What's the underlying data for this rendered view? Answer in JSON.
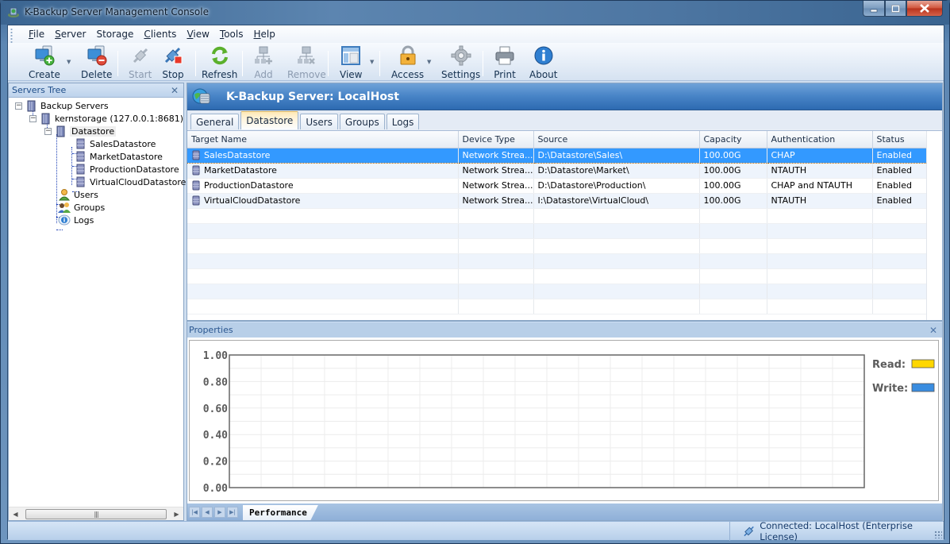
{
  "window": {
    "title": "K-Backup Server Management Console",
    "controls": {
      "minimize": "minimize",
      "maximize": "maximize",
      "close": "close"
    }
  },
  "menu": [
    {
      "label": "File",
      "mnemonic": "F"
    },
    {
      "label": "Server",
      "mnemonic": "S"
    },
    {
      "label": "Storage",
      "mnemonic": "g"
    },
    {
      "label": "Clients",
      "mnemonic": "C"
    },
    {
      "label": "View",
      "mnemonic": "V"
    },
    {
      "label": "Tools",
      "mnemonic": "T"
    },
    {
      "label": "Help",
      "mnemonic": "H"
    }
  ],
  "toolbar": {
    "create": {
      "label": "Create",
      "icon": "create-server-icon",
      "enabled": true
    },
    "delete": {
      "label": "Delete",
      "icon": "delete-server-icon",
      "enabled": true
    },
    "start": {
      "label": "Start",
      "icon": "plug-connect-icon",
      "enabled": false
    },
    "stop": {
      "label": "Stop",
      "icon": "plug-disconnect-icon",
      "enabled": true
    },
    "refresh": {
      "label": "Refresh",
      "icon": "refresh-icon",
      "enabled": true
    },
    "add": {
      "label": "Add",
      "icon": "add-network-icon",
      "enabled": false
    },
    "remove": {
      "label": "Remove",
      "icon": "remove-network-icon",
      "enabled": false
    },
    "view": {
      "label": "View",
      "icon": "layout-view-icon",
      "enabled": true
    },
    "access": {
      "label": "Access",
      "icon": "padlock-icon",
      "enabled": true
    },
    "settings": {
      "label": "Settings",
      "icon": "gear-icon",
      "enabled": true
    },
    "print": {
      "label": "Print",
      "icon": "printer-icon",
      "enabled": true
    },
    "about": {
      "label": "About",
      "icon": "info-icon",
      "enabled": true
    }
  },
  "servers_tree": {
    "title": "Servers Tree",
    "nodes": {
      "root": "Backup Servers",
      "server": "kernstorage (127.0.0.1:8681)",
      "datastore": "Datastore",
      "ds1": "SalesDatastore",
      "ds2": "MarketDatastore",
      "ds3": "ProductionDatastore",
      "ds4": "VirtualCloudDatastore",
      "users": "Users",
      "groups": "Groups",
      "logs": "Logs"
    },
    "selected": "Datastore"
  },
  "server_panel": {
    "title": "K-Backup Server: LocalHost",
    "tabs": [
      "General",
      "Datastore",
      "Users",
      "Groups",
      "Logs"
    ],
    "active_tab": "Datastore"
  },
  "datastore_table": {
    "columns": [
      "Target Name",
      "Device Type",
      "Source",
      "Capacity",
      "Authentication",
      "Status"
    ],
    "rows": [
      {
        "name": "SalesDatastore",
        "device": "Network Strea...",
        "source": "D:\\Datastore\\Sales\\",
        "capacity": "100.00G",
        "auth": "CHAP",
        "status": "Enabled"
      },
      {
        "name": "MarketDatastore",
        "device": "Network Strea...",
        "source": "D:\\Datastore\\Market\\",
        "capacity": "100.00G",
        "auth": "NTAUTH",
        "status": "Enabled"
      },
      {
        "name": "ProductionDatastore",
        "device": "Network Strea...",
        "source": "D:\\Datastore\\Production\\",
        "capacity": "100.00G",
        "auth": "CHAP and NTAUTH",
        "status": "Enabled"
      },
      {
        "name": "VirtualCloudDatastore",
        "device": "Network Strea...",
        "source": "I:\\Datastore\\VirtualCloud\\",
        "capacity": "100.00G",
        "auth": "NTAUTH",
        "status": "Enabled"
      }
    ],
    "selected_row": 0
  },
  "properties": {
    "title": "Properties",
    "sheet_tab": "Performance"
  },
  "chart_data": {
    "type": "line",
    "title": "",
    "xlabel": "",
    "ylabel": "",
    "ylim": [
      0,
      1
    ],
    "yticks": [
      "1.00",
      "0.80",
      "0.60",
      "0.40",
      "0.20",
      "0.00"
    ],
    "ytick_values": [
      1.0,
      0.8,
      0.6,
      0.4,
      0.2,
      0.0
    ],
    "grid": true,
    "legend_position": "right",
    "series": [
      {
        "name": "Read:",
        "color": "#ffd700",
        "values": []
      },
      {
        "name": "Write:",
        "color": "#3a8de0",
        "values": []
      }
    ]
  },
  "status": {
    "connection": "Connected: LocalHost (Enterprise License)"
  }
}
